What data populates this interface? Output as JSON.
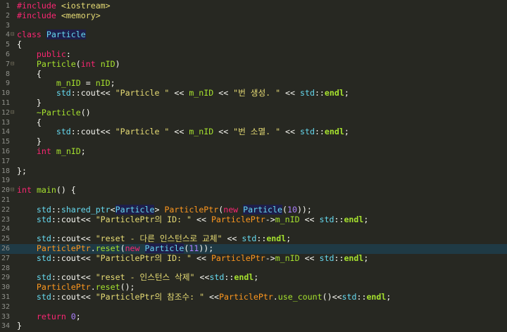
{
  "editor": {
    "lines": [
      {
        "n": "1",
        "fold": "",
        "tokens": [
          [
            "pp",
            "#include"
          ],
          [
            "plain",
            " "
          ],
          [
            "inc",
            "<iostream>"
          ]
        ]
      },
      {
        "n": "2",
        "fold": "",
        "tokens": [
          [
            "pp",
            "#include"
          ],
          [
            "plain",
            " "
          ],
          [
            "inc",
            "<memory>"
          ]
        ]
      },
      {
        "n": "3",
        "fold": "",
        "tokens": []
      },
      {
        "n": "4",
        "fold": "⊟",
        "tokens": [
          [
            "kw",
            "class"
          ],
          [
            "plain",
            " "
          ],
          [
            "clsdef",
            "Particle"
          ]
        ]
      },
      {
        "n": "5",
        "fold": "",
        "tokens": [
          [
            "plain",
            "{"
          ]
        ]
      },
      {
        "n": "6",
        "fold": "",
        "tokens": [
          [
            "plain",
            "    "
          ],
          [
            "kw",
            "public"
          ],
          [
            "plain",
            ":"
          ]
        ]
      },
      {
        "n": "7",
        "fold": "⊟",
        "tokens": [
          [
            "plain",
            "    "
          ],
          [
            "fn",
            "Particle"
          ],
          [
            "plain",
            "("
          ],
          [
            "type",
            "int"
          ],
          [
            "plain",
            " "
          ],
          [
            "var",
            "nID"
          ],
          [
            "plain",
            ")"
          ]
        ]
      },
      {
        "n": "8",
        "fold": "",
        "tokens": [
          [
            "plain",
            "    {"
          ]
        ]
      },
      {
        "n": "9",
        "fold": "",
        "tokens": [
          [
            "plain",
            "        "
          ],
          [
            "member",
            "m_nID"
          ],
          [
            "plain",
            " = "
          ],
          [
            "var",
            "nID"
          ],
          [
            "plain",
            ";"
          ]
        ]
      },
      {
        "n": "10",
        "fold": "",
        "tokens": [
          [
            "plain",
            "        "
          ],
          [
            "ns",
            "std"
          ],
          [
            "plain",
            "::cout<< "
          ],
          [
            "str",
            "\"Particle \""
          ],
          [
            "plain",
            " << "
          ],
          [
            "member",
            "m_nID"
          ],
          [
            "plain",
            " << "
          ],
          [
            "str",
            "\"번 생성. \""
          ],
          [
            "plain",
            " << "
          ],
          [
            "ns",
            "std"
          ],
          [
            "plain",
            "::"
          ],
          [
            "bold",
            "endl"
          ],
          [
            "plain",
            ";"
          ]
        ]
      },
      {
        "n": "11",
        "fold": "",
        "tokens": [
          [
            "plain",
            "    }"
          ]
        ]
      },
      {
        "n": "12",
        "fold": "⊟",
        "tokens": [
          [
            "plain",
            "    "
          ],
          [
            "fn",
            "~Particle"
          ],
          [
            "plain",
            "()"
          ]
        ]
      },
      {
        "n": "13",
        "fold": "",
        "tokens": [
          [
            "plain",
            "    {"
          ]
        ]
      },
      {
        "n": "14",
        "fold": "",
        "tokens": [
          [
            "plain",
            "        "
          ],
          [
            "ns",
            "std"
          ],
          [
            "plain",
            "::cout<< "
          ],
          [
            "str",
            "\"Particle \""
          ],
          [
            "plain",
            " << "
          ],
          [
            "member",
            "m_nID"
          ],
          [
            "plain",
            " << "
          ],
          [
            "str",
            "\"번 소멸. \""
          ],
          [
            "plain",
            " << "
          ],
          [
            "ns",
            "std"
          ],
          [
            "plain",
            "::"
          ],
          [
            "bold",
            "endl"
          ],
          [
            "plain",
            ";"
          ]
        ]
      },
      {
        "n": "15",
        "fold": "",
        "tokens": [
          [
            "plain",
            "    }"
          ]
        ]
      },
      {
        "n": "16",
        "fold": "",
        "tokens": [
          [
            "plain",
            "    "
          ],
          [
            "type",
            "int"
          ],
          [
            "plain",
            " "
          ],
          [
            "member",
            "m_nID"
          ],
          [
            "plain",
            ";"
          ]
        ]
      },
      {
        "n": "17",
        "fold": "",
        "tokens": []
      },
      {
        "n": "18",
        "fold": "",
        "tokens": [
          [
            "plain",
            "};"
          ]
        ]
      },
      {
        "n": "19",
        "fold": "",
        "tokens": []
      },
      {
        "n": "20",
        "fold": "⊟",
        "tokens": [
          [
            "type",
            "int"
          ],
          [
            "plain",
            " "
          ],
          [
            "fn",
            "main"
          ],
          [
            "plain",
            "() {"
          ]
        ]
      },
      {
        "n": "21",
        "fold": "",
        "tokens": []
      },
      {
        "n": "22",
        "fold": "",
        "tokens": [
          [
            "plain",
            "    "
          ],
          [
            "ns",
            "std"
          ],
          [
            "plain",
            "::"
          ],
          [
            "ns",
            "shared_ptr"
          ],
          [
            "plain",
            "<"
          ],
          [
            "clsdef",
            "Particle"
          ],
          [
            "plain",
            "> "
          ],
          [
            "macro",
            "ParticlePtr"
          ],
          [
            "plain",
            "("
          ],
          [
            "kw",
            "new"
          ],
          [
            "plain",
            " "
          ],
          [
            "clsdef",
            "Particle"
          ],
          [
            "plain",
            "("
          ],
          [
            "num",
            "10"
          ],
          [
            "plain",
            "));"
          ]
        ]
      },
      {
        "n": "23",
        "fold": "",
        "tokens": [
          [
            "plain",
            "    "
          ],
          [
            "ns",
            "std"
          ],
          [
            "plain",
            "::cout<< "
          ],
          [
            "str",
            "\"ParticlePtr의 ID: \""
          ],
          [
            "plain",
            " << "
          ],
          [
            "macro",
            "ParticlePtr"
          ],
          [
            "plain",
            "->"
          ],
          [
            "member",
            "m_nID"
          ],
          [
            "plain",
            " << "
          ],
          [
            "ns",
            "std"
          ],
          [
            "plain",
            "::"
          ],
          [
            "bold",
            "endl"
          ],
          [
            "plain",
            ";"
          ]
        ]
      },
      {
        "n": "24",
        "fold": "",
        "tokens": []
      },
      {
        "n": "25",
        "fold": "",
        "tokens": [
          [
            "plain",
            "    "
          ],
          [
            "ns",
            "std"
          ],
          [
            "plain",
            "::cout<< "
          ],
          [
            "str",
            "\"reset - 다른 인스턴스로 교체\""
          ],
          [
            "plain",
            " << "
          ],
          [
            "ns",
            "std"
          ],
          [
            "plain",
            "::"
          ],
          [
            "bold",
            "endl"
          ],
          [
            "plain",
            ";"
          ]
        ]
      },
      {
        "n": "26",
        "fold": "",
        "hl": true,
        "tokens": [
          [
            "plain",
            "    "
          ],
          [
            "macro",
            "ParticlePtr"
          ],
          [
            "plain",
            "."
          ],
          [
            "fn",
            "reset"
          ],
          [
            "plain",
            "("
          ],
          [
            "kw",
            "new"
          ],
          [
            "plain",
            " "
          ],
          [
            "clsdef",
            "Particle"
          ],
          [
            "plain",
            "("
          ],
          [
            "num",
            "11"
          ],
          [
            "plain",
            "));"
          ]
        ]
      },
      {
        "n": "27",
        "fold": "",
        "tokens": [
          [
            "plain",
            "    "
          ],
          [
            "ns",
            "std"
          ],
          [
            "plain",
            "::cout<< "
          ],
          [
            "str",
            "\"ParticlePtr의 ID: \""
          ],
          [
            "plain",
            " << "
          ],
          [
            "macro",
            "ParticlePtr"
          ],
          [
            "plain",
            "->"
          ],
          [
            "member",
            "m_nID"
          ],
          [
            "plain",
            " << "
          ],
          [
            "ns",
            "std"
          ],
          [
            "plain",
            "::"
          ],
          [
            "bold",
            "endl"
          ],
          [
            "plain",
            ";"
          ]
        ]
      },
      {
        "n": "28",
        "fold": "",
        "tokens": []
      },
      {
        "n": "29",
        "fold": "",
        "tokens": [
          [
            "plain",
            "    "
          ],
          [
            "ns",
            "std"
          ],
          [
            "plain",
            "::cout<< "
          ],
          [
            "str",
            "\"reset - 인스턴스 삭제\""
          ],
          [
            "plain",
            " <<"
          ],
          [
            "ns",
            "std"
          ],
          [
            "plain",
            "::"
          ],
          [
            "bold",
            "endl"
          ],
          [
            "plain",
            ";"
          ]
        ]
      },
      {
        "n": "30",
        "fold": "",
        "tokens": [
          [
            "plain",
            "    "
          ],
          [
            "macro",
            "ParticlePtr"
          ],
          [
            "plain",
            "."
          ],
          [
            "fn",
            "reset"
          ],
          [
            "plain",
            "();"
          ]
        ]
      },
      {
        "n": "31",
        "fold": "",
        "tokens": [
          [
            "plain",
            "    "
          ],
          [
            "ns",
            "std"
          ],
          [
            "plain",
            "::cout<< "
          ],
          [
            "str",
            "\"ParticlePtr의 참조수: \""
          ],
          [
            "plain",
            " <<"
          ],
          [
            "macro",
            "ParticlePtr"
          ],
          [
            "plain",
            "."
          ],
          [
            "fn",
            "use_count"
          ],
          [
            "plain",
            "()<<"
          ],
          [
            "ns",
            "std"
          ],
          [
            "plain",
            "::"
          ],
          [
            "bold",
            "endl"
          ],
          [
            "plain",
            ";"
          ]
        ]
      },
      {
        "n": "32",
        "fold": "",
        "tokens": []
      },
      {
        "n": "33",
        "fold": "",
        "tokens": [
          [
            "plain",
            "    "
          ],
          [
            "kw",
            "return"
          ],
          [
            "plain",
            " "
          ],
          [
            "num",
            "0"
          ],
          [
            "plain",
            ";"
          ]
        ]
      },
      {
        "n": "34",
        "fold": "",
        "tokens": [
          [
            "plain",
            "}"
          ]
        ]
      }
    ]
  },
  "colors": {
    "background": "#272822",
    "current_line": "#1f3a45",
    "line_number": "#8f908a"
  }
}
